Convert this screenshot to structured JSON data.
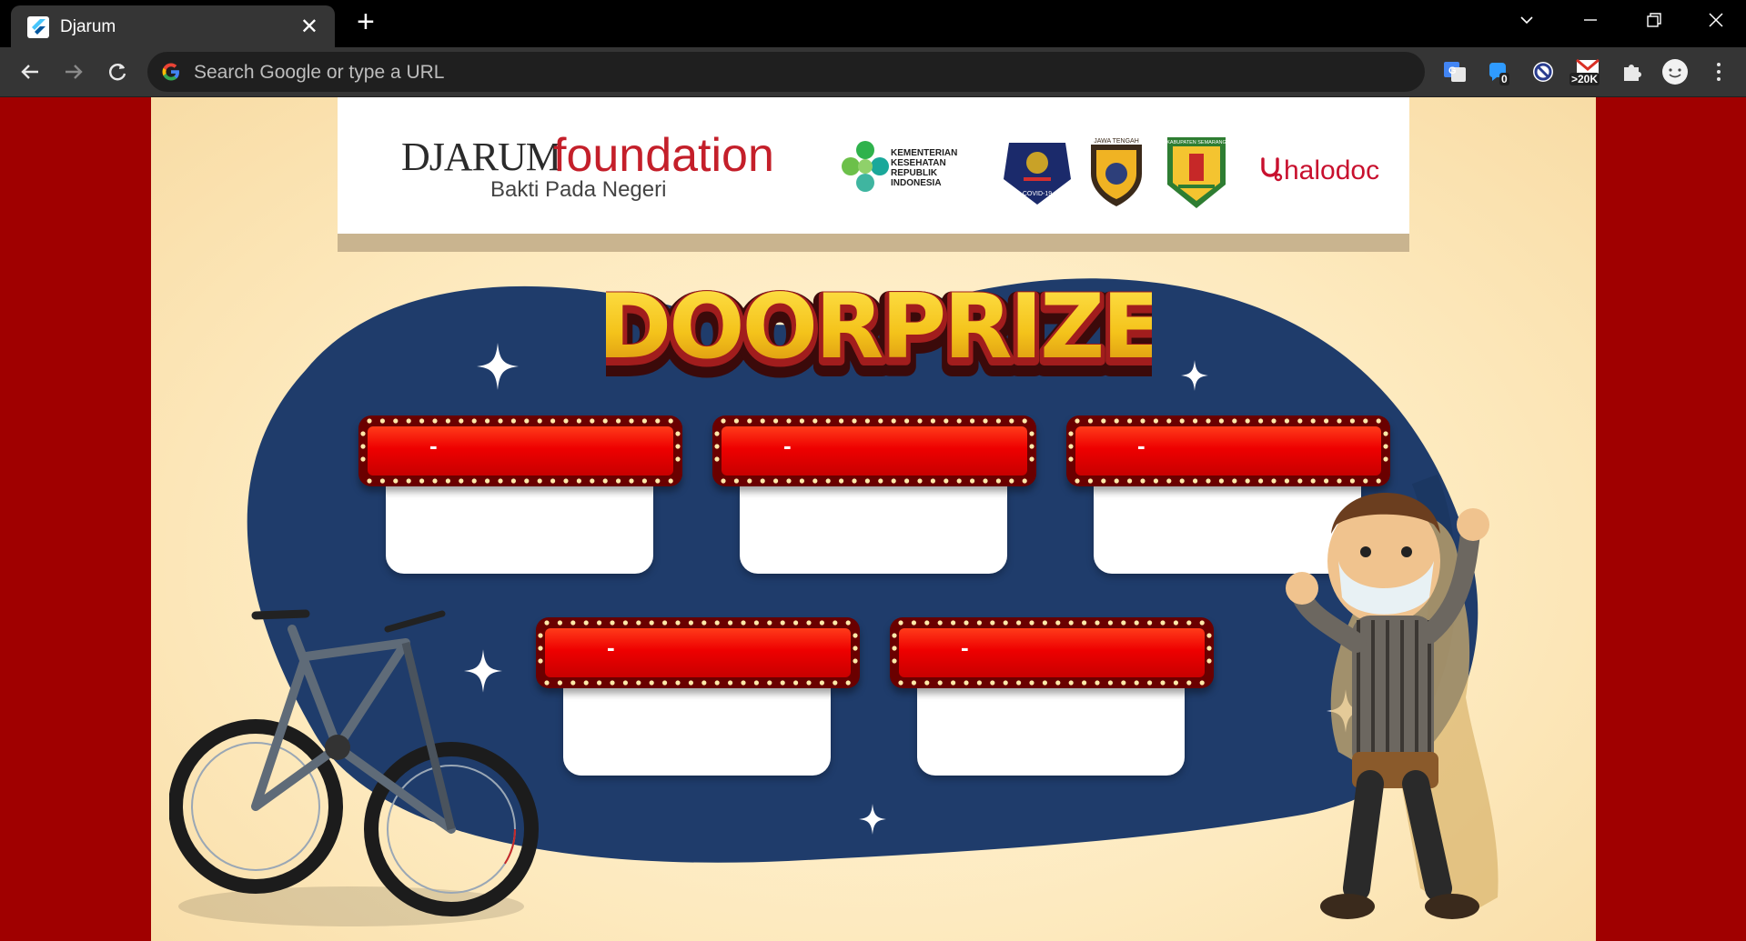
{
  "browser": {
    "tab_title": "Djarum",
    "new_tab_symbol": "+",
    "close_symbol": "✕",
    "omnibox_placeholder": "Search Google or type a URL",
    "extensions": [
      {
        "name": "google-translate-icon"
      },
      {
        "name": "notification-extension-icon",
        "badge": "0"
      },
      {
        "name": "blocker-extension-icon"
      },
      {
        "name": "gmail-checker-icon",
        "badge": ">20K"
      },
      {
        "name": "puzzle-icon"
      },
      {
        "name": "profile-avatar-icon"
      },
      {
        "name": "kebab-menu-icon"
      }
    ]
  },
  "header": {
    "brand_main": "DJARUM",
    "brand_sub": "foundation",
    "tagline": "Bakti Pada Negeri",
    "kemenkes_lines": [
      "KEMENTERIAN",
      "KESEHATAN",
      "REPUBLIK",
      "INDONESIA"
    ],
    "satgas_label": "COVID-19",
    "jateng_label": "JAWA TENGAH",
    "kabupaten_label": "KABUPATEN SEMARANG",
    "halodoc_label": "halodoc"
  },
  "main": {
    "title": "DOORPRIZE",
    "prizes": [
      {
        "label": "-",
        "value": ""
      },
      {
        "label": "-",
        "value": ""
      },
      {
        "label": "-",
        "value": ""
      },
      {
        "label": "-",
        "value": ""
      },
      {
        "label": "-",
        "value": ""
      }
    ]
  },
  "colors": {
    "page_red": "#a00000",
    "blob_blue": "#1f3c6b",
    "marquee_red": "#ee0000",
    "title_gold": "#f4c31b",
    "brand_red": "#c41f2a"
  }
}
